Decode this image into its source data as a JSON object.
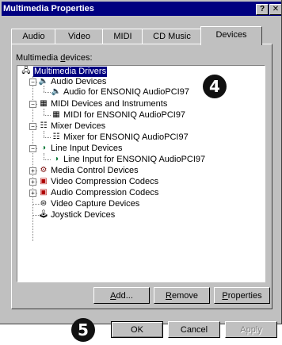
{
  "window": {
    "title": "Multimedia Properties",
    "help_button": "?",
    "close_button": "✕"
  },
  "tabs": [
    {
      "label": "Audio"
    },
    {
      "label": "Video"
    },
    {
      "label": "MIDI"
    },
    {
      "label": "CD Music"
    },
    {
      "label": "Devices",
      "active": true
    }
  ],
  "devices_label_prefix": "Multimedia ",
  "devices_label_accel": "d",
  "devices_label_suffix": "evices:",
  "tree": {
    "root": "Multimedia Drivers",
    "items": [
      {
        "label": "Audio Devices",
        "children": [
          "Audio for ENSONIQ AudioPCI97"
        ]
      },
      {
        "label": "MIDI Devices and Instruments",
        "children": [
          "MIDI for ENSONIQ AudioPCI97"
        ]
      },
      {
        "label": "Mixer Devices",
        "children": [
          "Mixer for ENSONIQ AudioPCI97"
        ]
      },
      {
        "label": "Line Input Devices",
        "children": [
          "Line Input for ENSONIQ AudioPCI97"
        ]
      },
      {
        "label": "Media Control Devices"
      },
      {
        "label": "Video Compression Codecs"
      },
      {
        "label": "Audio Compression Codecs"
      },
      {
        "label": "Video Capture Devices"
      },
      {
        "label": "Joystick Devices"
      }
    ]
  },
  "buttons": {
    "add_accel": "A",
    "add_rest": "dd...",
    "remove_accel": "R",
    "remove_rest": "emove",
    "properties_accel": "P",
    "properties_rest": "roperties",
    "ok": "OK",
    "cancel": "Cancel",
    "apply": "Apply"
  },
  "callouts": {
    "one": "4",
    "two": "5"
  }
}
